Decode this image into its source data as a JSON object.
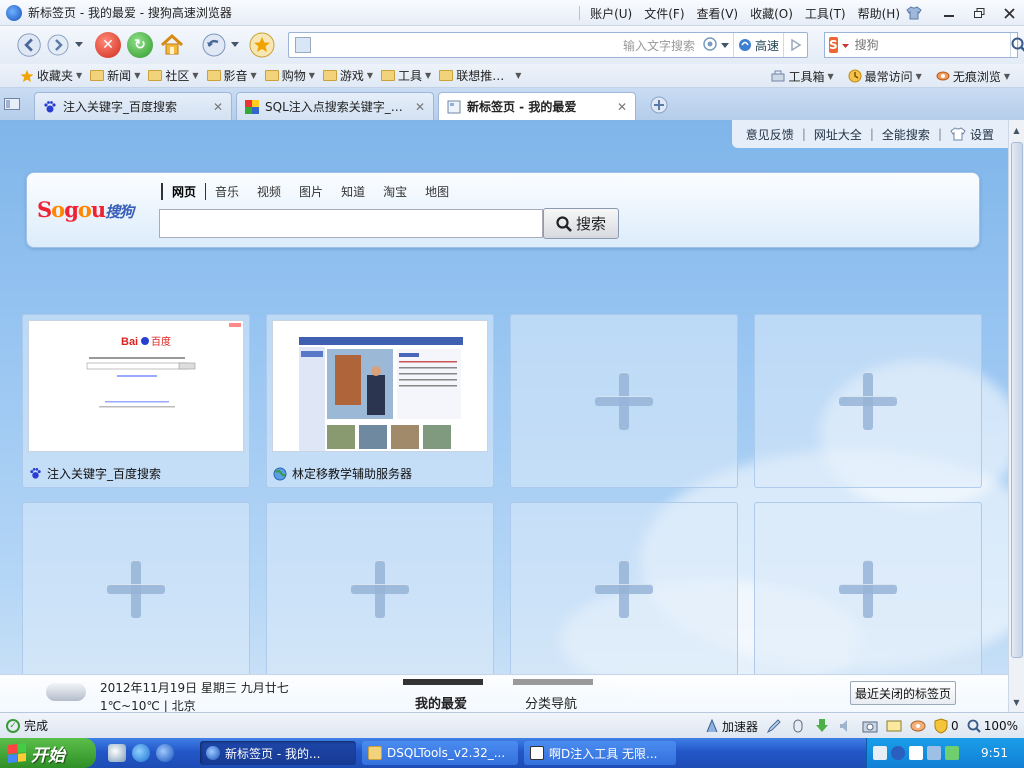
{
  "window": {
    "title": "新标签页 - 我的最爱 - 搜狗高速浏览器",
    "menu": [
      "账户(U)",
      "文件(F)",
      "查看(V)",
      "收藏(O)",
      "工具(T)",
      "帮助(H)"
    ]
  },
  "nav": {
    "address_value": "",
    "address_hint": "输入文字搜索",
    "speed_label": "高速",
    "search_placeholder": "搜狗"
  },
  "bookmarks": {
    "left": [
      "收藏夹",
      "新闻",
      "社区",
      "影音",
      "购物",
      "游戏",
      "工具",
      "联想推…"
    ],
    "right": [
      "工具箱",
      "最常访问",
      "无痕浏览"
    ]
  },
  "tabs": [
    {
      "label": "注入关键字_百度搜索",
      "active": false
    },
    {
      "label": "SQL注入点搜索关键字_…",
      "active": false
    },
    {
      "label": "新标签页 - 我的最爱",
      "active": true
    }
  ],
  "toplinks": [
    "意见反馈",
    "网址大全",
    "全能搜索",
    "设置"
  ],
  "sogou": {
    "logo": "Sogou搜狗",
    "tabs": [
      "网页",
      "音乐",
      "视频",
      "图片",
      "知道",
      "淘宝",
      "地图"
    ],
    "button": "搜索",
    "input_value": ""
  },
  "tiles": [
    {
      "label": "注入关键字_百度搜索",
      "type": "site"
    },
    {
      "label": "林定移教学辅助服务器",
      "type": "site"
    },
    {
      "label": "",
      "type": "empty"
    },
    {
      "label": "",
      "type": "empty"
    },
    {
      "label": "",
      "type": "empty"
    },
    {
      "label": "",
      "type": "empty"
    },
    {
      "label": "",
      "type": "empty"
    },
    {
      "label": "",
      "type": "empty"
    }
  ],
  "bottom": {
    "date": "2012年11月19日 星期三 九月廿七",
    "weather": "1℃~10℃ | 北京",
    "tab_favorites": "我的最爱",
    "tab_categories": "分类导航",
    "recent_closed": "最近关闭的标签页"
  },
  "status": {
    "text": "完成",
    "accelerator": "加速器",
    "count": "0",
    "zoom": "100%"
  },
  "taskbar": {
    "start": "开始",
    "tasks": [
      "新标签页 - 我的...",
      "DSQLTools_v2.32_...",
      "啊D注入工具 无限..."
    ],
    "clock": "9:51"
  },
  "colors": {
    "accent": "#2357c8",
    "content_top": "#7fb5ea",
    "start_green": "#2f8f27"
  }
}
